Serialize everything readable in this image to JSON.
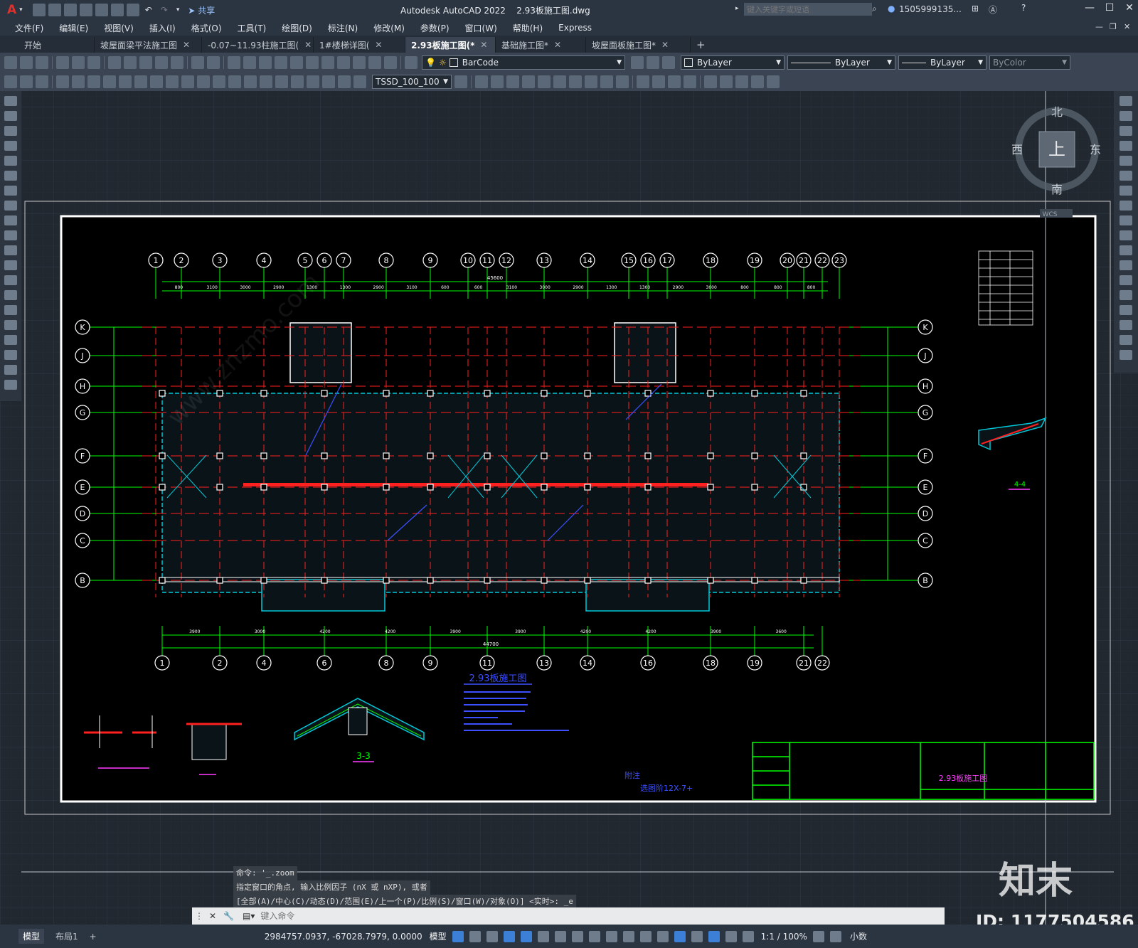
{
  "app": {
    "name": "Autodesk AutoCAD 2022",
    "file": "2.93板施工图.dwg",
    "share": "共享"
  },
  "titlebar": {
    "search_placeholder": "键入关键字或短语",
    "user": "1505999135...",
    "logo": "A"
  },
  "menu": [
    "文件(F)",
    "编辑(E)",
    "视图(V)",
    "插入(I)",
    "格式(O)",
    "工具(T)",
    "绘图(D)",
    "标注(N)",
    "修改(M)",
    "参数(P)",
    "窗口(W)",
    "帮助(H)",
    "Express"
  ],
  "tabs": [
    {
      "label": "开始",
      "closable": false,
      "active": false
    },
    {
      "label": "坡屋面梁平法施工图",
      "closable": true,
      "active": false
    },
    {
      "label": "-0.07~11.93柱施工图(",
      "closable": true,
      "active": false
    },
    {
      "label": "1#楼梯详图(",
      "closable": true,
      "active": false
    },
    {
      "label": "2.93板施工图(*",
      "closable": true,
      "active": true
    },
    {
      "label": "基础施工图*",
      "closable": true,
      "active": false
    },
    {
      "label": "坡屋面板施工图*",
      "closable": true,
      "active": false
    }
  ],
  "toolbar": {
    "layer": "BarCode",
    "color": "ByLayer",
    "linetype": "ByLayer",
    "lineweight": "ByLayer",
    "plotstyle": "ByColor",
    "textstyle": "TSSD_100_100"
  },
  "viewcube": {
    "north": "北",
    "south": "南",
    "east": "东",
    "west": "西",
    "top": "上",
    "wcs": "WCS"
  },
  "drawing": {
    "axes_top": [
      "1",
      "2",
      "3",
      "4",
      "5",
      "6",
      "7",
      "8",
      "9",
      "10",
      "11",
      "12",
      "13",
      "14",
      "15",
      "16",
      "17",
      "18",
      "19",
      "20",
      "21",
      "22",
      "23"
    ],
    "axes_bottom": [
      "1",
      "2",
      "4",
      "6",
      "8",
      "9",
      "11",
      "13",
      "14",
      "16",
      "18",
      "19",
      "21",
      "22"
    ],
    "axes_rows": [
      "K",
      "J",
      "H",
      "G",
      "F",
      "E",
      "D",
      "C",
      "B"
    ],
    "top_dims": [
      "800",
      "3100",
      "3000",
      "2900",
      "1300",
      "1300",
      "2900",
      "3100",
      "600",
      "600",
      "3100",
      "3000",
      "2900",
      "1300",
      "1300",
      "2900",
      "3000",
      "800",
      "800",
      "800"
    ],
    "overall_top": "45600",
    "bottom_dims": [
      "3900",
      "3000",
      "4200",
      "4200",
      "3900",
      "3900",
      "4200",
      "4200",
      "3900",
      "3600"
    ],
    "overall_bottom": "44700",
    "plan_title": "2.93板施工图",
    "section_33": "3-3",
    "section_44": "4-4",
    "note_label": "附注",
    "note_text": "选图阶12X-7+",
    "titleblock_name": "2.93板施工图"
  },
  "commandline": {
    "lines": [
      "命令: '_.zoom",
      "指定窗口的角点, 输入比例因子 (nX 或 nXP), 或者",
      "[全部(A)/中心(C)/动态(D)/范围(E)/上一个(P)/比例(S)/窗口(W)/对象(O)] <实时>: _e"
    ],
    "placeholder": "键入命令"
  },
  "layout_tabs": [
    "模型",
    "布局1"
  ],
  "status": {
    "coords": "2984757.0937, -67028.7979, 0.0000",
    "space": "模型",
    "scale": "1:1 / 100%",
    "units": "小数"
  },
  "watermark": {
    "brand": "知末",
    "id": "ID: 1177504586",
    "site": "www.znzmo.com"
  },
  "colors": {
    "bg": "#212830",
    "grid": "#2a323c",
    "axis": "#00ff00",
    "red": "#ff2020",
    "cyan": "#00c8d8",
    "white": "#ffffff",
    "magenta": "#ff3cff",
    "blue": "#3c50ff"
  }
}
